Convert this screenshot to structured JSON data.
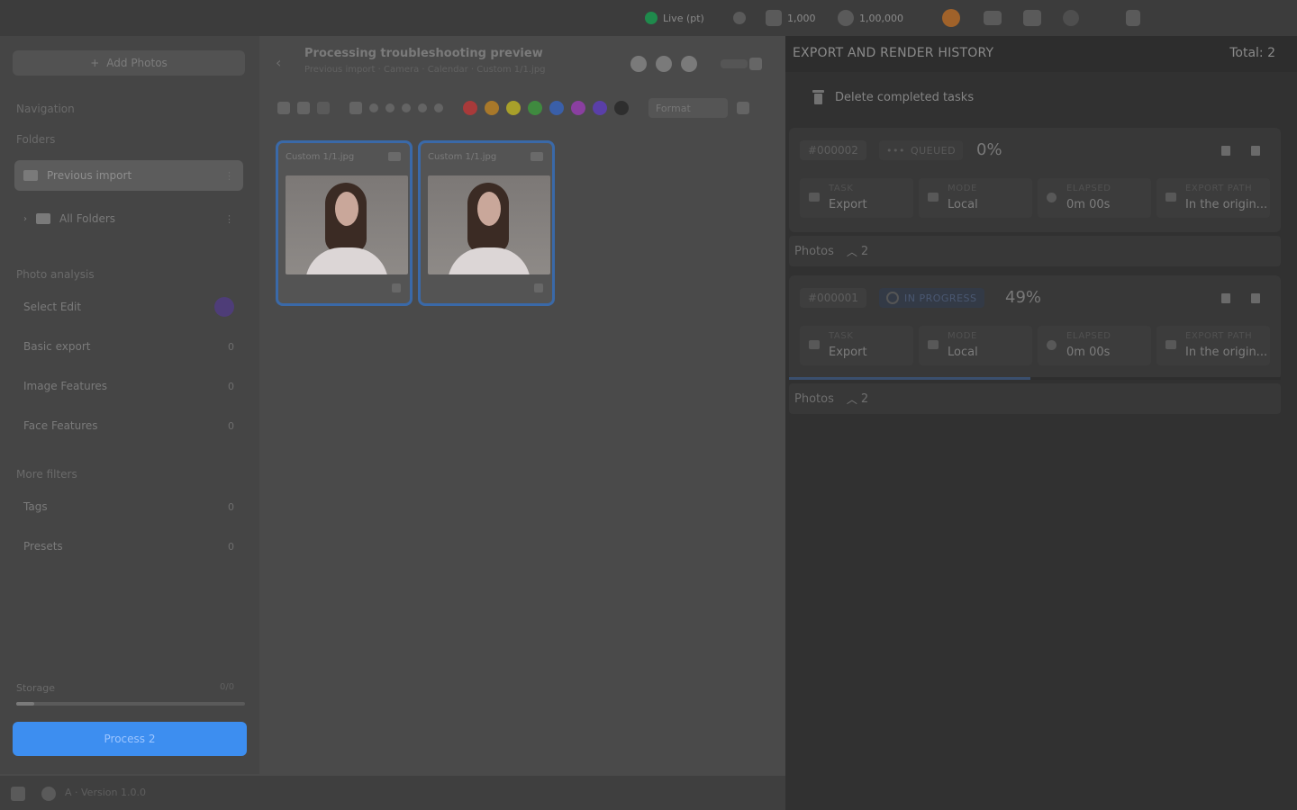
{
  "topbar": {
    "status_label": "Live (pt)",
    "stat1": "1,000",
    "stat2": "1,00,000"
  },
  "sidebar": {
    "add_label": "Add Photos",
    "navigation_label": "Navigation",
    "folders_label": "Folders",
    "project_item": "Previous import",
    "all_folders_item": "All Folders",
    "lists_label": "Photo analysis",
    "items": [
      {
        "label": "Select Edit",
        "count": ""
      },
      {
        "label": "Basic export",
        "count": "0"
      },
      {
        "label": "Image Features",
        "count": "0"
      },
      {
        "label": "Face Features",
        "count": "0"
      }
    ],
    "more_label": "More filters",
    "more_items": [
      {
        "label": "Tags",
        "count": "0"
      },
      {
        "label": "Presets",
        "count": "0"
      }
    ],
    "storage_label": "Storage",
    "storage_value": "0/0",
    "storage_fraction": 0.08,
    "primary_label": "Process 2"
  },
  "bottombar": {
    "text": "A · Version 1.0.0"
  },
  "main": {
    "title": "Processing troubleshooting preview",
    "subtitle": "Previous import  ·  Camera  ·  Calendar  ·  Custom 1/1.jpg",
    "format_label": "Format",
    "thumbs": [
      {
        "name": "Custom 1/1.jpg"
      },
      {
        "name": "Custom 1/1.jpg"
      }
    ],
    "swatches": [
      "#a83a3a",
      "#a8782a",
      "#a8a02a",
      "#3f8a3f",
      "#3a5fa8",
      "#8a3fa0",
      "#5a3fa8",
      "#2e2e2e"
    ]
  },
  "panel": {
    "title": "EXPORT AND RENDER HISTORY",
    "total": "Total: 2",
    "delete_label": "Delete completed tasks",
    "tasks": [
      {
        "id": "#000002",
        "status": "QUEUED",
        "status_icon": "dots-icon",
        "percent": "0%",
        "progress": 0,
        "task_label": "TASK",
        "task_value": "Export",
        "mode_label": "MODE",
        "mode_value": "Local",
        "elapsed_label": "ELAPSED",
        "elapsed_value": "0m 00s",
        "path_label": "EXPORT PATH",
        "path_value": "In the origin...",
        "photos_label": "Photos",
        "photos_count": "2"
      },
      {
        "id": "#000001",
        "status": "IN PROGRESS",
        "status_icon": "spinner-icon",
        "percent": "49%",
        "progress": 0.49,
        "task_label": "TASK",
        "task_value": "Export",
        "mode_label": "MODE",
        "mode_value": "Local",
        "elapsed_label": "ELAPSED",
        "elapsed_value": "0m 00s",
        "path_label": "EXPORT PATH",
        "path_value": "In the origin...",
        "photos_label": "Photos",
        "photos_count": "2"
      }
    ]
  }
}
